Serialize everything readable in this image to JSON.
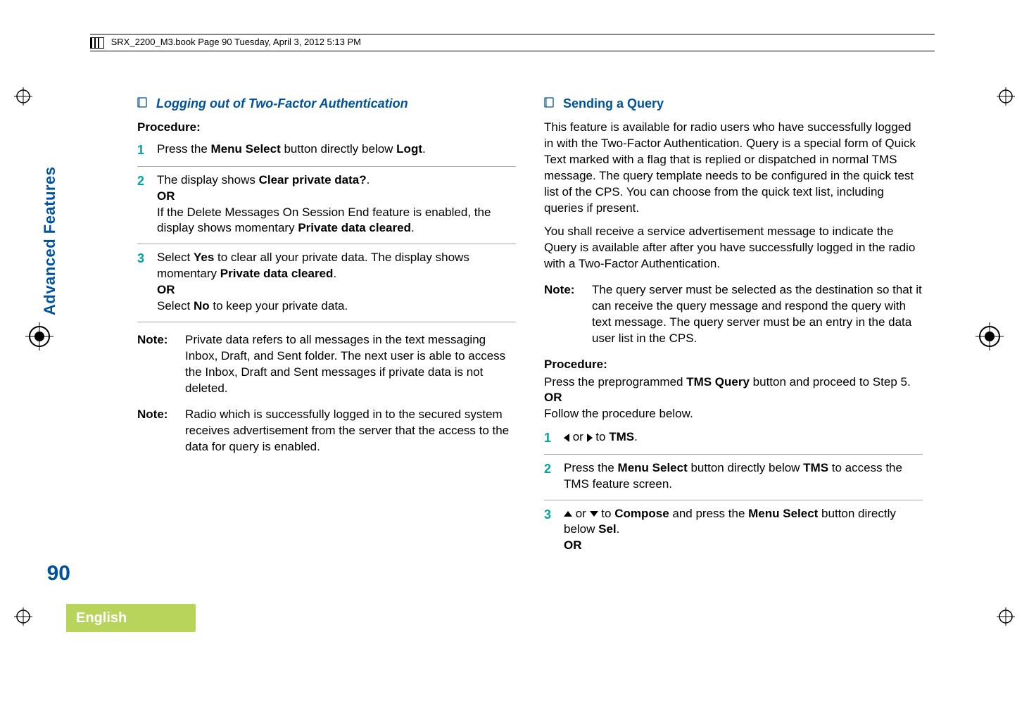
{
  "header": {
    "running_head": "SRX_2200_M3.book  Page 90  Tuesday, April 3, 2012  5:13 PM"
  },
  "sidebar": {
    "tab_label": "Advanced Features",
    "page_number": "90",
    "language": "English"
  },
  "left": {
    "heading": "Logging out of Two-Factor Authentication",
    "procedure_label": "Procedure:",
    "steps": {
      "s1": {
        "num": "1",
        "pre": "Press the ",
        "bold": "Menu Select",
        "mid": " button directly below ",
        "disp": "Logt",
        "post": "."
      },
      "s2": {
        "num": "2",
        "line1_pre": "The display shows ",
        "line1_disp": "Clear private data?",
        "line1_post": ".",
        "or": "OR",
        "line2a": "If the Delete Messages On Session End feature is enabled, the display shows momentary ",
        "line2_disp": "Private data cleared",
        "line2_post": "."
      },
      "s3": {
        "num": "3",
        "line1_pre": "Select ",
        "line1_disp": "Yes",
        "line1_mid": " to clear all your private data. The display shows momentary ",
        "line1_disp2": "Private data cleared",
        "line1_post": ".",
        "or": "OR",
        "line2_pre": "Select ",
        "line2_disp": "No",
        "line2_post": " to keep your private data."
      }
    },
    "note1": {
      "label": "Note:",
      "body": "Private data refers to all messages in the text messaging Inbox, Draft, and Sent folder. The next user is able to access the Inbox, Draft and Sent messages if private data is not deleted."
    },
    "note2": {
      "label": "Note:",
      "body": "Radio which is successfully logged in to the secured system receives advertisement from the server that the access to the data for query is enabled."
    }
  },
  "right": {
    "heading": "Sending a Query",
    "para1": "This feature is available for radio users who have successfully logged in with the Two-Factor Authentication. Query is a special form of Quick Text marked with a flag that is replied or dispatched in normal TMS message. The query template needs to be configured in the quick test list of the CPS. You can choose from the quick text list, including queries if present.",
    "para2": "You shall receive a service advertisement message to indicate the Query is available after after you have successfully logged in the radio with a Two-Factor Authentication.",
    "note": {
      "label": "Note:",
      "body": "The query server must be selected as the destination so that it can receive the query message and respond the query with text message. The query server must be an entry in the data user list in the CPS."
    },
    "procedure_label": "Procedure:",
    "preline_a": "Press the preprogrammed ",
    "preline_bold": "TMS Query",
    "preline_b": " button and proceed to Step 5.",
    "or": "OR",
    "preline2": "Follow the procedure below.",
    "steps": {
      "s1": {
        "num": "1",
        "mid": " or ",
        "to": " to ",
        "disp": "TMS",
        "post": "."
      },
      "s2": {
        "num": "2",
        "pre": "Press the ",
        "bold": "Menu Select",
        "mid": " button directly below ",
        "disp": "TMS",
        "post": " to access the TMS feature screen."
      },
      "s3": {
        "num": "3",
        "mid": " or ",
        "to": " to ",
        "disp": "Compose",
        "mid2": " and press the ",
        "bold": "Menu Select",
        "mid3": " button directly below ",
        "disp2": "Sel",
        "post": ".",
        "or": "OR"
      }
    }
  }
}
